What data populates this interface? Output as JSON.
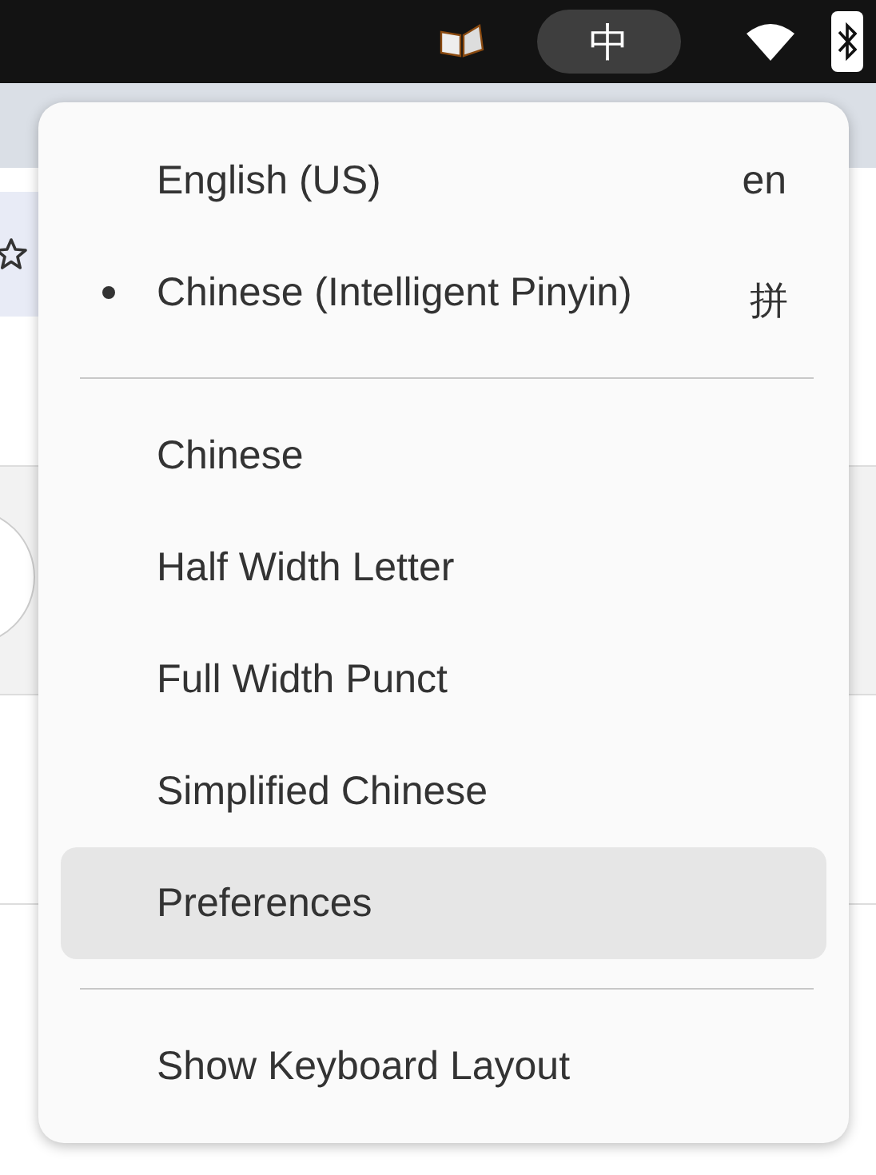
{
  "top_bar": {
    "input_method": {
      "label": "中",
      "selected": true
    }
  },
  "menu": {
    "entries": [
      {
        "kind": "item",
        "label": "English (US)",
        "suffix": "en",
        "selected": false,
        "hovered": false
      },
      {
        "kind": "item",
        "label": "Chinese (Intelligent Pinyin)",
        "suffix": "拼",
        "selected": true,
        "hovered": false
      },
      {
        "kind": "separator"
      },
      {
        "kind": "item",
        "label": "Chinese",
        "selected": false,
        "hovered": false
      },
      {
        "kind": "item",
        "label": "Half Width Letter",
        "selected": false,
        "hovered": false
      },
      {
        "kind": "item",
        "label": "Full Width Punct",
        "selected": false,
        "hovered": false
      },
      {
        "kind": "item",
        "label": "Simplified Chinese",
        "selected": false,
        "hovered": false
      },
      {
        "kind": "item",
        "label": "Preferences",
        "selected": false,
        "hovered": true
      },
      {
        "kind": "separator"
      },
      {
        "kind": "item",
        "label": "Show Keyboard Layout",
        "selected": false,
        "hovered": false
      }
    ]
  }
}
